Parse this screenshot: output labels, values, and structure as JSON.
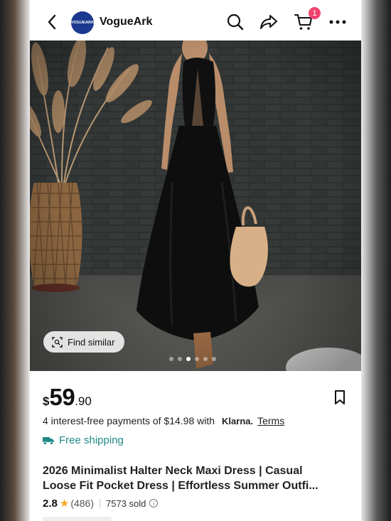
{
  "header": {
    "logo_text": "VOGUEARK",
    "store_name": "VogueArk",
    "cart_badge": "1"
  },
  "hero": {
    "find_similar_label": "Find similar",
    "carousel_total": 6,
    "carousel_active": 3
  },
  "price": {
    "currency": "$",
    "integer": "59",
    "decimal": ".90"
  },
  "financing": {
    "text": "4 interest-free payments of $14.98 with",
    "provider": "Klarna.",
    "terms_label": "Terms"
  },
  "shipping": {
    "label": "Free shipping"
  },
  "product": {
    "title_line1": "2026 Minimalist Halter Neck Maxi Dress |   Casual",
    "title_line2": "Loose Fit Pocket Dress |   Effortless Summer Outfi..."
  },
  "stats": {
    "rating": "2.8",
    "reviews": "(486)",
    "sold": "7573 sold"
  },
  "colors": {
    "accent_teal": "#1f8a88",
    "badge_pink": "#f0446e",
    "star": "#f5a623"
  }
}
